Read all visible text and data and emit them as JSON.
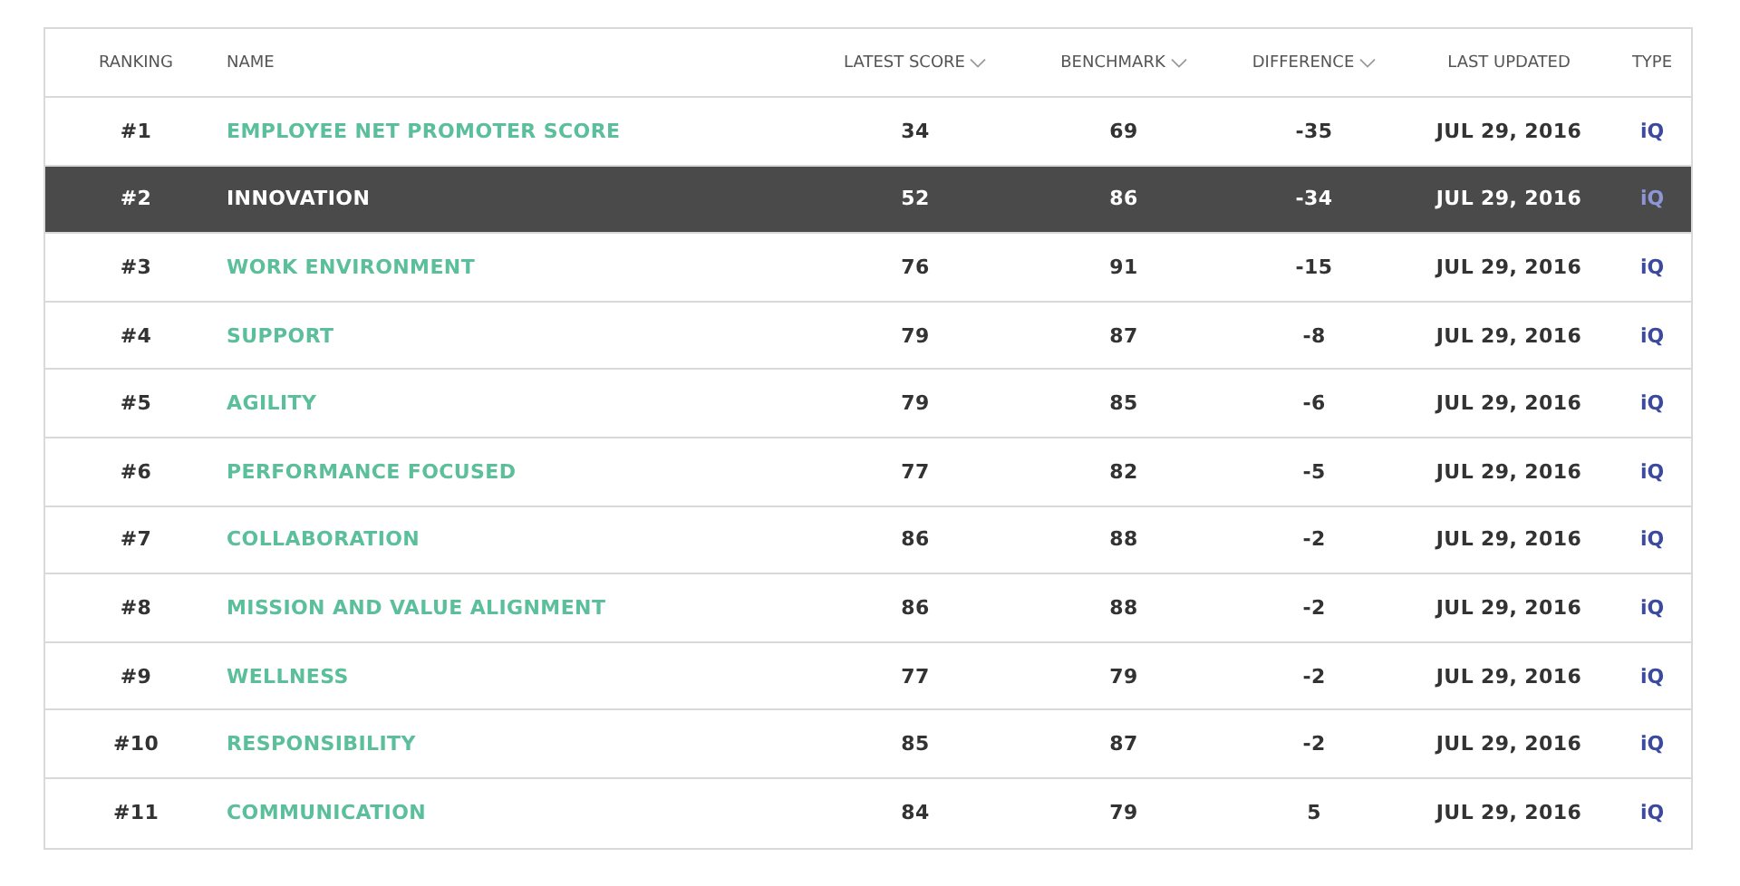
{
  "table": {
    "columns": [
      {
        "label": "RANKING",
        "sortable": false
      },
      {
        "label": "NAME",
        "sortable": false
      },
      {
        "label": "LATEST SCORE",
        "sortable": true
      },
      {
        "label": "BENCHMARK",
        "sortable": true
      },
      {
        "label": "DIFFERENCE",
        "sortable": true
      },
      {
        "label": "LAST UPDATED",
        "sortable": false
      },
      {
        "label": "TYPE",
        "sortable": false
      }
    ],
    "rows": [
      {
        "rank": "#1",
        "name": "EMPLOYEE NET PROMOTER SCORE",
        "latest_score": "34",
        "benchmark": "69",
        "difference": "-35",
        "last_updated": "JUL 29, 2016",
        "type": "iQ",
        "selected": false
      },
      {
        "rank": "#2",
        "name": "INNOVATION",
        "latest_score": "52",
        "benchmark": "86",
        "difference": "-34",
        "last_updated": "JUL 29, 2016",
        "type": "iQ",
        "selected": true
      },
      {
        "rank": "#3",
        "name": "WORK ENVIRONMENT",
        "latest_score": "76",
        "benchmark": "91",
        "difference": "-15",
        "last_updated": "JUL 29, 2016",
        "type": "iQ",
        "selected": false
      },
      {
        "rank": "#4",
        "name": "SUPPORT",
        "latest_score": "79",
        "benchmark": "87",
        "difference": "-8",
        "last_updated": "JUL 29, 2016",
        "type": "iQ",
        "selected": false
      },
      {
        "rank": "#5",
        "name": "AGILITY",
        "latest_score": "79",
        "benchmark": "85",
        "difference": "-6",
        "last_updated": "JUL 29, 2016",
        "type": "iQ",
        "selected": false
      },
      {
        "rank": "#6",
        "name": "PERFORMANCE FOCUSED",
        "latest_score": "77",
        "benchmark": "82",
        "difference": "-5",
        "last_updated": "JUL 29, 2016",
        "type": "iQ",
        "selected": false
      },
      {
        "rank": "#7",
        "name": "COLLABORATION",
        "latest_score": "86",
        "benchmark": "88",
        "difference": "-2",
        "last_updated": "JUL 29, 2016",
        "type": "iQ",
        "selected": false
      },
      {
        "rank": "#8",
        "name": "MISSION AND VALUE ALIGNMENT",
        "latest_score": "86",
        "benchmark": "88",
        "difference": "-2",
        "last_updated": "JUL 29, 2016",
        "type": "iQ",
        "selected": false
      },
      {
        "rank": "#9",
        "name": "WELLNESS",
        "latest_score": "77",
        "benchmark": "79",
        "difference": "-2",
        "last_updated": "JUL 29, 2016",
        "type": "iQ",
        "selected": false
      },
      {
        "rank": "#10",
        "name": "RESPONSIBILITY",
        "latest_score": "85",
        "benchmark": "87",
        "difference": "-2",
        "last_updated": "JUL 29, 2016",
        "type": "iQ",
        "selected": false
      },
      {
        "rank": "#11",
        "name": "COMMUNICATION",
        "latest_score": "84",
        "benchmark": "79",
        "difference": "5",
        "last_updated": "JUL 29, 2016",
        "type": "iQ",
        "selected": false
      }
    ]
  }
}
